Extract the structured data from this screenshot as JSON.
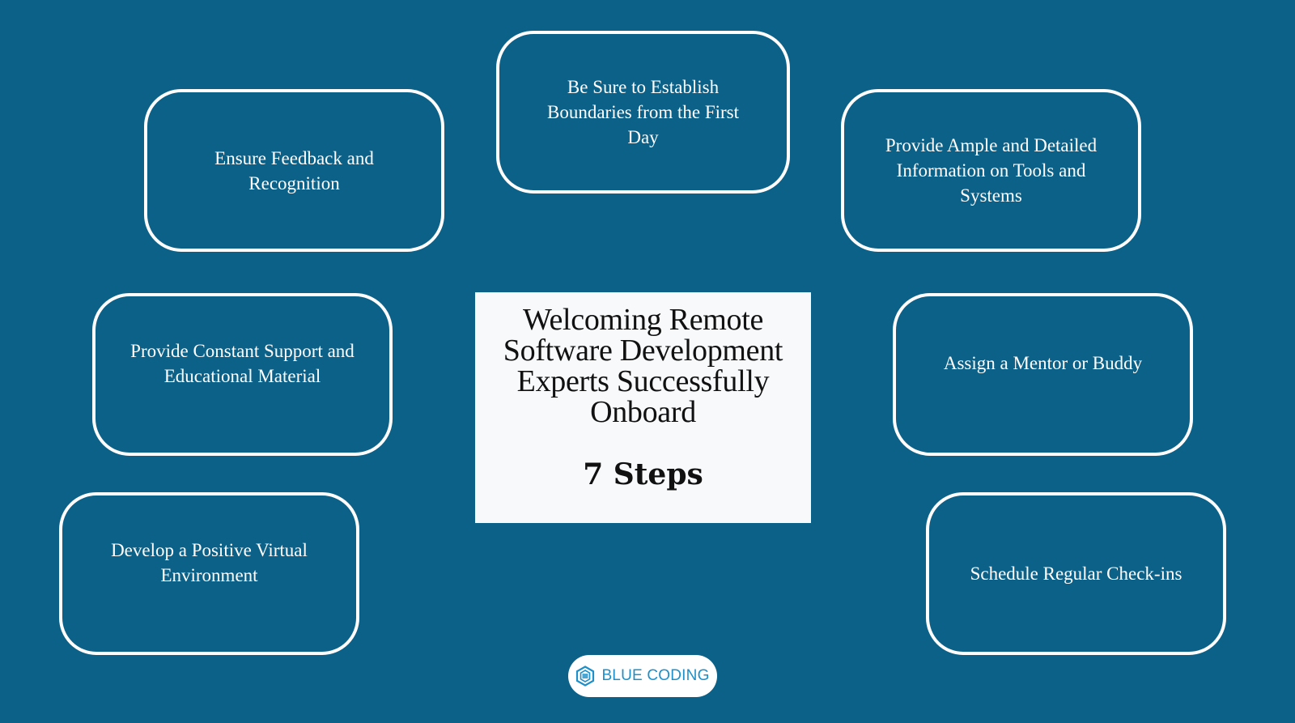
{
  "center": {
    "title": "Welcoming Remote Software Development Experts Successfully Onboard",
    "subtitle": "7 Steps"
  },
  "steps": [
    {
      "label": "Be Sure to Establish Boundaries from the First Day"
    },
    {
      "label": "Ensure Feedback and Recognition"
    },
    {
      "label": "Provide Ample and Detailed Information on Tools and Systems"
    },
    {
      "label": "Provide Constant Support and Educational Material"
    },
    {
      "label": "Assign a Mentor or Buddy"
    },
    {
      "label": "Develop a Positive Virtual Environment"
    },
    {
      "label": "Schedule Regular Check-ins"
    }
  ],
  "logo": {
    "text": "BLUE CODING",
    "icon": "hexagon-logo-icon"
  },
  "colors": {
    "background": "#0b6188",
    "box_border": "#ffffff",
    "card_background": "#f7f9fb",
    "logo_accent": "#1e8fc9"
  }
}
